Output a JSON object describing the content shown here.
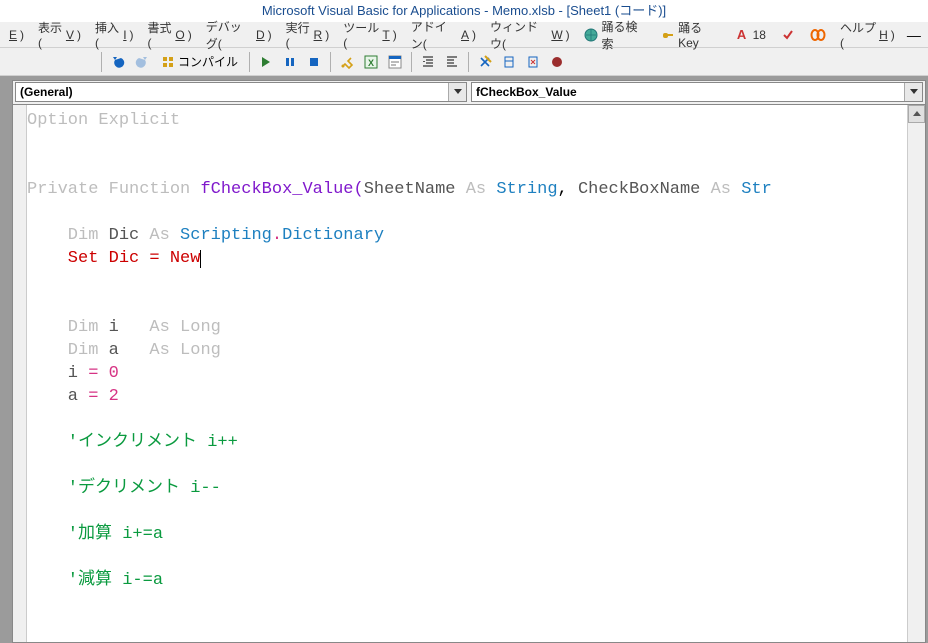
{
  "title": "Microsoft Visual Basic for Applications - Memo.xlsb - [Sheet1 (コード)]",
  "menu": {
    "edit_suffix": ")",
    "view": "表示(",
    "view_u": "V",
    "insert": "挿入(",
    "insert_u": "I",
    "format": "書式(",
    "format_u": "O",
    "debug": "デバッグ(",
    "debug_u": "D",
    "run": "実行(",
    "run_u": "R",
    "tools": "ツール(",
    "tools_u": "T",
    "addins": "アドイン(",
    "addins_u": "A",
    "window": "ウィンドウ(",
    "window_u": "W",
    "ext1": "踊る検索",
    "ext2": "踊るKey",
    "ext3": "18",
    "help": "ヘルプ(",
    "help_u": "H"
  },
  "toolbar": {
    "compile": "コンパイル"
  },
  "dropdowns": {
    "left": "(General)",
    "right": "fCheckBox_Value"
  },
  "code": {
    "l1_option": "Option",
    "l1_explicit": " Explicit",
    "l3_private": "Private",
    "l3_function": " Function",
    "l3_fname": " fCheckBox_Value",
    "l3_open": "(",
    "l3_p1": "SheetName",
    "l3_as1": " As ",
    "l3_t1": "String",
    "l3_comma": ",",
    "l3_p2": " CheckBoxName",
    "l3_as2": " As ",
    "l3_t2": "Str",
    "l5_dim": "    Dim",
    "l5_dic": " Dic",
    "l5_as": " As ",
    "l5_scripting": "Scripting",
    "l5_dot": ".",
    "l5_dict": "Dictionary",
    "l6_set": "    Set Dic = New",
    "l8_dim": "    Dim",
    "l8_i": " i  ",
    "l8_as": " As ",
    "l8_long": "Long",
    "l9_dim": "    Dim",
    "l9_a": " a  ",
    "l9_as": " As ",
    "l9_long": "Long",
    "l10_i": "    i",
    "l10_eq": " = ",
    "l10_0": "0",
    "l11_a": "    a",
    "l11_eq": " = ",
    "l11_2": "2",
    "l13": "    'インクリメント i++",
    "l15": "    'デクリメント i--",
    "l17": "    '加算 i+=a",
    "l19": "    '減算 i-=a"
  }
}
